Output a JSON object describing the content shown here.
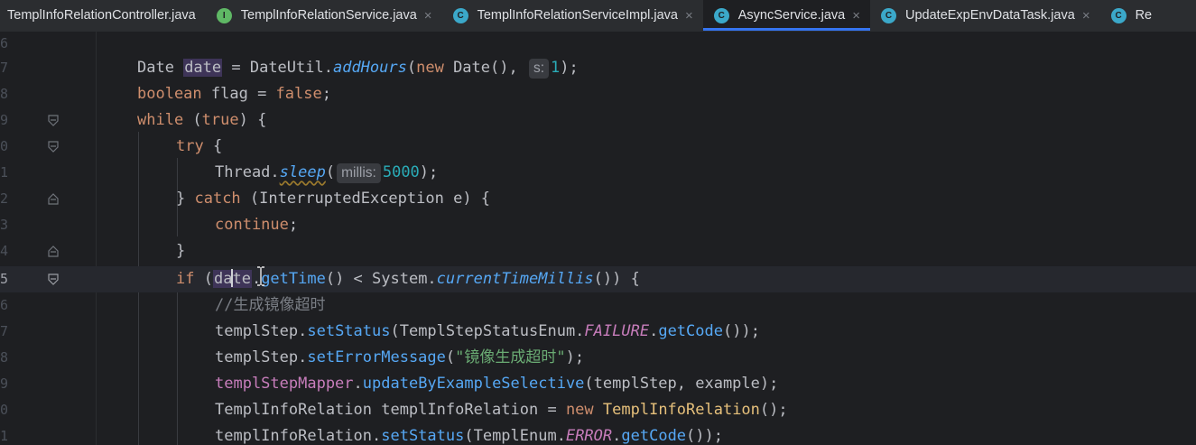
{
  "tabs": [
    {
      "label": "TemplInfoRelationController.java",
      "icon": "none",
      "close": ""
    },
    {
      "label": "TemplInfoRelationService.java",
      "icon": "interface-icon",
      "icon_glyph": "I",
      "icon_color": "#5fb865",
      "close": "×"
    },
    {
      "label": "TemplInfoRelationServiceImpl.java",
      "icon": "class-icon",
      "icon_glyph": "C",
      "icon_color": "#3ba8c9",
      "close": "×"
    },
    {
      "label": "AsyncService.java",
      "icon": "class-icon",
      "icon_glyph": "C",
      "icon_color": "#3ba8c9",
      "close": "×",
      "active": true
    },
    {
      "label": "UpdateExpEnvDataTask.java",
      "icon": "class-icon",
      "icon_glyph": "C",
      "icon_color": "#3ba8c9",
      "close": "×"
    },
    {
      "label": "Re",
      "icon": "class-icon",
      "icon_glyph": "C",
      "icon_color": "#3ba8c9",
      "close": ""
    }
  ],
  "gutter": {
    "line_numbers": [
      "6",
      "7",
      "8",
      "9",
      "0",
      "1",
      "2",
      "3",
      "4",
      "5",
      "6",
      "7",
      "8",
      "9",
      "0",
      "1"
    ]
  },
  "code": {
    "l1": {
      "t1": "Date ",
      "var": "date",
      "t2": " = DateUtil.",
      "fn": "addHours",
      "t3": "(",
      "kw": "new",
      "t4": " Date(), ",
      "hint": "s:",
      "num": "1",
      "t5": ");"
    },
    "l2": {
      "kw1": "boolean",
      "t1": " flag = ",
      "kw2": "false",
      "t2": ";"
    },
    "l3": {
      "kw1": "while",
      "t1": " (",
      "kw2": "true",
      "t2": ") {"
    },
    "l4": {
      "kw": "try",
      "t1": " {"
    },
    "l5": {
      "t1": "Thread.",
      "fn": "sleep",
      "t2": "(",
      "hint": "millis:",
      "num": "5000",
      "t3": ");"
    },
    "l6": {
      "t1": "} ",
      "kw": "catch",
      "t2": " (InterruptedException ",
      "param": "e",
      "t3": ") {"
    },
    "l7": {
      "kw": "continue",
      "t1": ";"
    },
    "l8": {
      "t1": "}"
    },
    "l9": {
      "kw": "if",
      "t1": " (",
      "var_a": "da",
      "var_b": "te",
      "t2": ".",
      "fn1": "getTime",
      "t3": "() < System.",
      "fn2": "currentTimeMillis",
      "t4": "()) {"
    },
    "l10": {
      "cm": "//生成镜像超时"
    },
    "l11": {
      "t1": "templStep.",
      "fn1": "setStatus",
      "t2": "(TemplStepStatusEnum.",
      "cst": "FAILURE",
      "t3": ".",
      "fn2": "getCode",
      "t4": "());"
    },
    "l12": {
      "t1": "templStep.",
      "fn": "setErrorMessage",
      "t2": "(",
      "str": "\"镜像生成超时\"",
      "t3": ");"
    },
    "l13": {
      "fld": "templStepMapper",
      "t1": ".",
      "fn": "updateByExampleSelective",
      "t2": "(templStep, example);"
    },
    "l14": {
      "t1": "TemplInfoRelation templInfoRelation = ",
      "kw": "new",
      "t2": " ",
      "cls": "TemplInfoRelation",
      "t3": "();"
    },
    "l15": {
      "t1": "templInfoRelation.",
      "fn1": "setStatus",
      "t2": "(TemplEnum.",
      "cst": "ERROR",
      "t3": ".",
      "fn2": "getCode",
      "t4": "());"
    }
  }
}
